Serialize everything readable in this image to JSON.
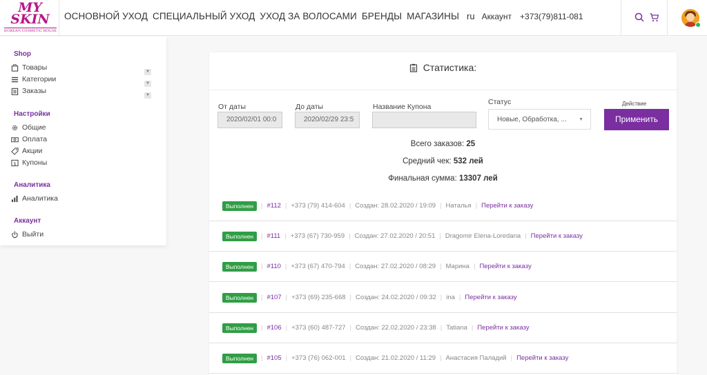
{
  "brand": {
    "line1": "MY",
    "line2": "SKIN",
    "tagline": "KOREAN COSMETIC HOUSE",
    "accent_color": "#7a2ea0",
    "logo_color": "#b5198a"
  },
  "header": {
    "nav": [
      {
        "label": "ОСНОВНОЙ УХОД"
      },
      {
        "label": "СПЕЦИАЛЬНЫЙ УХОД"
      },
      {
        "label": "УХОД ЗА ВОЛОСАМИ"
      },
      {
        "label": "БРЕНДЫ"
      },
      {
        "label": "МАГАЗИНЫ"
      }
    ],
    "lang": "ru",
    "account": "Аккаунт",
    "phone": "+373(79)811-081",
    "icons": [
      "search-icon",
      "cart-icon",
      "avatar"
    ]
  },
  "sidebar": {
    "sections": [
      {
        "title": "Shop",
        "items": [
          {
            "label": "Товары",
            "icon": "bag-icon",
            "expandable": true
          },
          {
            "label": "Категории",
            "icon": "list-icon",
            "expandable": true
          },
          {
            "label": "Заказы",
            "icon": "clipboard-icon",
            "expandable": true
          }
        ]
      },
      {
        "title": "Настройки",
        "items": [
          {
            "label": "Общие",
            "icon": "gear-icon"
          },
          {
            "label": "Оплата",
            "icon": "money-icon"
          },
          {
            "label": "Акции",
            "icon": "tag-icon"
          },
          {
            "label": "Купоны",
            "icon": "coupon-icon"
          }
        ]
      },
      {
        "title": "Аналитика",
        "items": [
          {
            "label": "Аналитика",
            "icon": "bar-chart-icon"
          }
        ]
      },
      {
        "title": "Аккаунт",
        "items": [
          {
            "label": "Выйти",
            "icon": "power-icon"
          }
        ]
      }
    ]
  },
  "stats_card": {
    "title": "Статистика:",
    "filters": {
      "date_from_label": "От даты",
      "date_from_value": "2020/02/01 00:0",
      "date_to_label": "До даты",
      "date_to_value": "2020/02/29 23:5",
      "coupon_label": "Название Купона",
      "coupon_value": "",
      "status_label": "Статус",
      "status_value": "Новые, Обработка, ...",
      "action_label": "Действие",
      "apply_label": "Применить"
    },
    "summary": {
      "total_orders_label": "Всего заказов:",
      "total_orders_value": "25",
      "avg_check_label": "Средний чек:",
      "avg_check_value": "532 лей",
      "final_sum_label": "Финальная сумма:",
      "final_sum_value": "13307 лей"
    },
    "orders": [
      {
        "status": "Выполнен",
        "number": "#112",
        "phone": "+373 (79) 414-604",
        "created": "Создан: 28.02.2020 / 19:09",
        "name": "Наталья",
        "link": "Перейти к заказу"
      },
      {
        "status": "Выполнен",
        "number": "#111",
        "phone": "+373 (67) 730-959",
        "created": "Создан: 27.02.2020 / 20:51",
        "name": "Dragomir Elena-Loredana",
        "link": "Перейти к заказу"
      },
      {
        "status": "Выполнен",
        "number": "#110",
        "phone": "+373 (67) 470-794",
        "created": "Создан: 27.02.2020 / 08:29",
        "name": "Марина",
        "link": "Перейти к заказу"
      },
      {
        "status": "Выполнен",
        "number": "#107",
        "phone": "+373 (69) 235-668",
        "created": "Создан: 24.02.2020 / 09:32",
        "name": "ina",
        "link": "Перейти к заказу"
      },
      {
        "status": "Выполнен",
        "number": "#106",
        "phone": "+373 (60) 487-727",
        "created": "Создан: 22.02.2020 / 23:38",
        "name": "Tatiana",
        "link": "Перейти к заказу"
      },
      {
        "status": "Выполнен",
        "number": "#105",
        "phone": "+373 (76) 062-001",
        "created": "Создан: 21.02.2020 / 11:29",
        "name": "Анастасия Паладий",
        "link": "Перейти к заказу"
      }
    ],
    "status_color": "#2f9e44"
  }
}
